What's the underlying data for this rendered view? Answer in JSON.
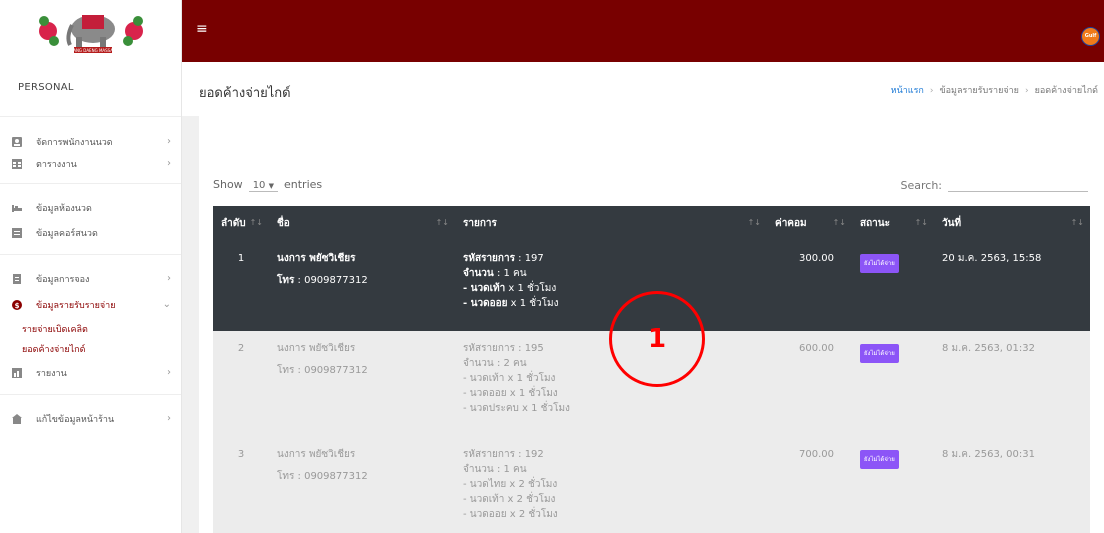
{
  "sidebar": {
    "logo_text": "CHANG DAENG MASSAGE",
    "user_label": "PERSONAL",
    "items": [
      {
        "label": "จัดการพนักงานนวด",
        "icon": "user-card-icon"
      },
      {
        "label": "ตารางงาน",
        "icon": "calendar-grid-icon"
      },
      {
        "label": "ข้อมูลห้องนวด",
        "icon": "bed-icon"
      },
      {
        "label": "ข้อมูลคอร์สนวด",
        "icon": "list-icon"
      },
      {
        "label": "ข้อมูลการจอง",
        "icon": "document-icon"
      },
      {
        "label": "ข้อมูลรายรับรายจ่าย",
        "icon": "money-icon"
      },
      {
        "label": "รายงาน",
        "icon": "report-icon"
      },
      {
        "label": "แก้ไขข้อมูลหน้าร้าน",
        "icon": "shop-icon"
      }
    ],
    "subitems": [
      "รายจ่ายเบิดเคลิต",
      "ยอดค้างจ่ายไกด์"
    ]
  },
  "topbar": {
    "menu_icon": "hamburger-icon",
    "avatar_label": "Gulf"
  },
  "header": {
    "title": "ยอดค้างจ่ายไกด์",
    "breadcrumb": [
      "หน้าแรก",
      "ข้อมูลรายรับรายจ่าย",
      "ยอดค้างจ่ายไกด์"
    ]
  },
  "table": {
    "show_label": "Show",
    "entries_value": "10",
    "entries_label": "entries",
    "search_label": "Search:",
    "search_value": "",
    "columns": [
      "ลำดับ",
      "ชื่อ",
      "รายการ",
      "ค่าคอม",
      "สถานะ",
      "วันที่"
    ],
    "rows": [
      {
        "no": "1",
        "name": "นงการ พยัซวิเชียร",
        "tel_label": "โทร",
        "tel": ": 0909877312",
        "code_label": "รหัสรายการ",
        "code": ": 197",
        "qty_label": "จำนวน",
        "qty": ": 1 คน",
        "items": [
          {
            "name": "- นวดเท้า",
            "qty": " x 1 ชั่วโมง"
          },
          {
            "name": "- นวดออย",
            "qty": " x 1 ชั่วโมง"
          }
        ],
        "commission": "300.00",
        "status": "ยังไม่ได้จ่าย",
        "date": "20 ม.ค. 2563, 15:58"
      },
      {
        "no": "2",
        "name": "นงการ พยัซวิเชียร",
        "tel_label": "โทร",
        "tel": ": 0909877312",
        "code_label": "รหัสรายการ",
        "code": ": 195",
        "qty_label": "จำนวน",
        "qty": ": 2 คน",
        "items": [
          {
            "name": "- นวดเท้า",
            "qty": " x 1 ชั่วโมง"
          },
          {
            "name": "- นวดออย",
            "qty": " x 1 ชั่วโมง"
          },
          {
            "name": "- นวดประคบ",
            "qty": " x 1 ชั่วโมง"
          }
        ],
        "commission": "600.00",
        "status": "ยังไม่ได้จ่าย",
        "date": "8 ม.ค. 2563, 01:32"
      },
      {
        "no": "3",
        "name": "นงการ พยัซวิเชียร",
        "tel_label": "โทร",
        "tel": ": 0909877312",
        "code_label": "รหัสรายการ",
        "code": ": 192",
        "qty_label": "จำนวน",
        "qty": ": 1 คน",
        "items": [
          {
            "name": "- นวดไทย",
            "qty": " x 2 ชั่วโมง"
          },
          {
            "name": "- นวดเท้า",
            "qty": " x 2 ชั่วโมง"
          },
          {
            "name": "- นวดออย",
            "qty": " x 2 ชั่วโมง"
          }
        ],
        "commission": "700.00",
        "status": "ยังไม่ได้จ่าย",
        "date": "8 ม.ค. 2563, 00:31"
      }
    ]
  },
  "annotation": {
    "label": "1",
    "color": "#ff0000"
  },
  "colors": {
    "topbar": "#780000",
    "table_header": "#343a40",
    "badge": "#8c55f7",
    "link": "#1f7bd6"
  }
}
